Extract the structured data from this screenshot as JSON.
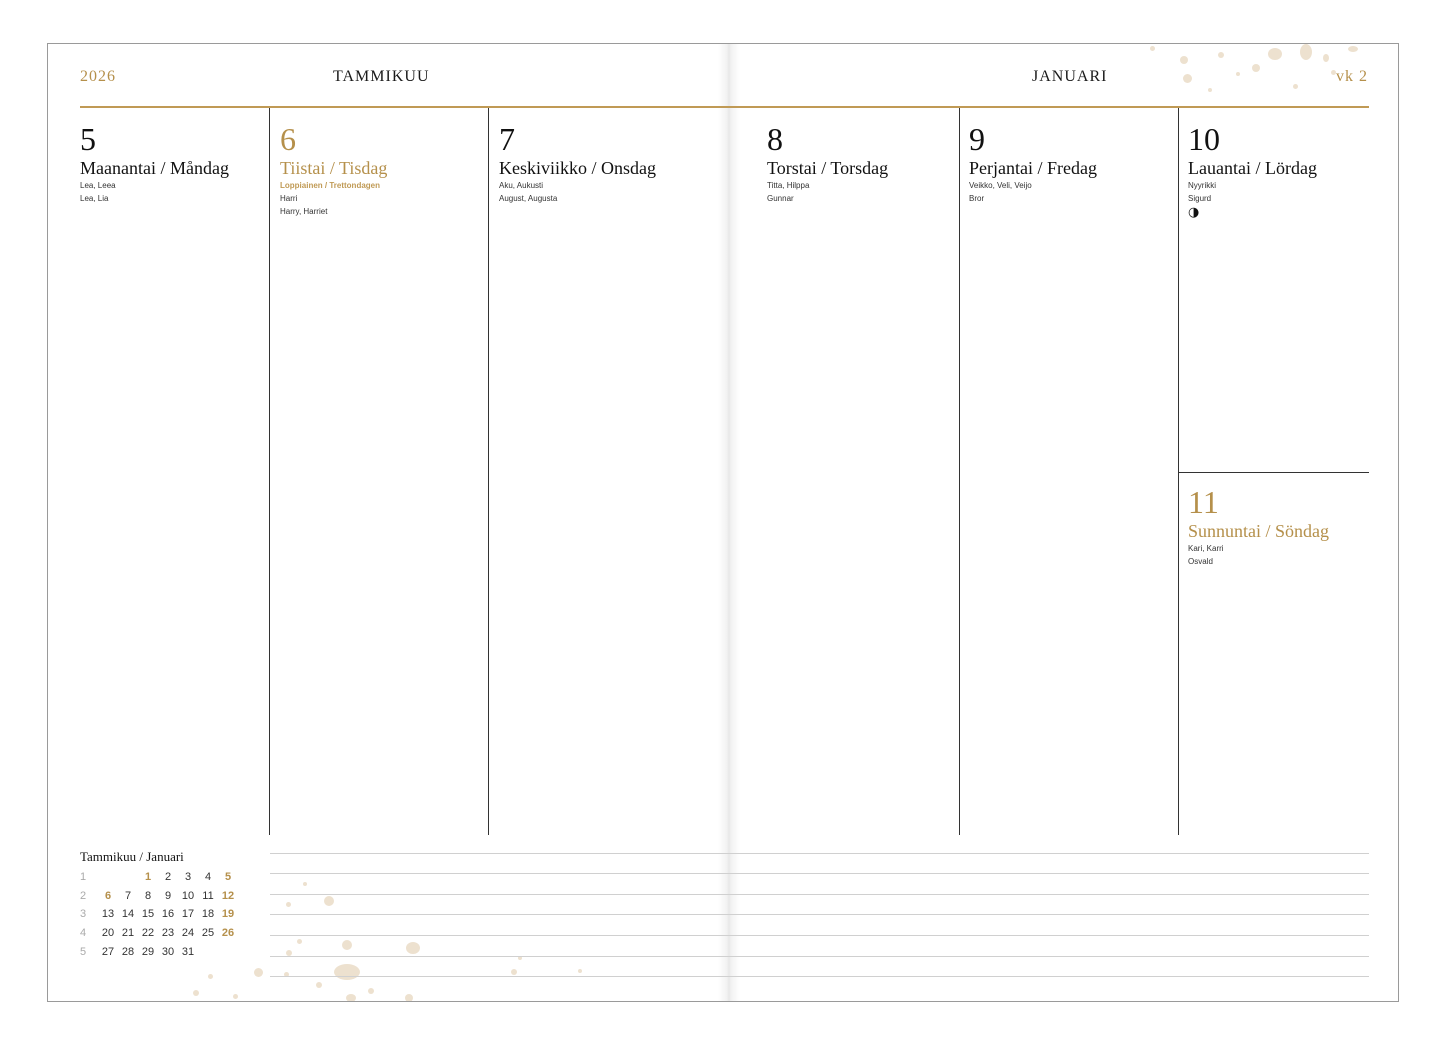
{
  "header": {
    "year": "2026",
    "month_fi": "TAMMIKUU",
    "month_sv": "JANUARI",
    "week": "vk 2"
  },
  "days": [
    {
      "num": "5",
      "name": "Maanantai / Måndag",
      "names": [
        "Lea, Leea",
        "Lea, Lia"
      ]
    },
    {
      "num": "6",
      "name": "Tiistai / Tisdag",
      "holiday": "Loppiainen / Trettondagen",
      "names": [
        "Harri",
        "Harry, Harriet"
      ]
    },
    {
      "num": "7",
      "name": "Keskiviikko / Onsdag",
      "names": [
        "Aku, Aukusti",
        "August, Augusta"
      ]
    },
    {
      "num": "8",
      "name": "Torstai / Torsdag",
      "names": [
        "Titta, Hilppa",
        "Gunnar"
      ]
    },
    {
      "num": "9",
      "name": "Perjantai / Fredag",
      "names": [
        "Veikko, Veli, Veijo",
        "Bror"
      ]
    },
    {
      "num": "10",
      "name": "Lauantai / Lördag",
      "names": [
        "Nyyrikki",
        "Sigurd"
      ],
      "moon": "◑"
    },
    {
      "num": "11",
      "name": "Sunnuntai / Söndag",
      "names": [
        "Kari, Karri",
        "Osvald"
      ]
    }
  ],
  "mini_calendar": {
    "title": "Tammikuu / Januari",
    "rows": [
      {
        "week": "1",
        "days": [
          "",
          "",
          "1",
          "2",
          "3",
          "4",
          "5"
        ]
      },
      {
        "week": "2",
        "days": [
          "6",
          "7",
          "8",
          "9",
          "10",
          "11",
          "12"
        ]
      },
      {
        "week": "3",
        "days": [
          "13",
          "14",
          "15",
          "16",
          "17",
          "18",
          "19"
        ]
      },
      {
        "week": "4",
        "days": [
          "20",
          "21",
          "22",
          "23",
          "24",
          "25",
          "26"
        ]
      },
      {
        "week": "5",
        "days": [
          "27",
          "28",
          "29",
          "30",
          "31",
          "",
          ""
        ]
      }
    ]
  },
  "colors": {
    "accent": "#b5904b",
    "rule": "#c09a55",
    "text": "#111111"
  }
}
